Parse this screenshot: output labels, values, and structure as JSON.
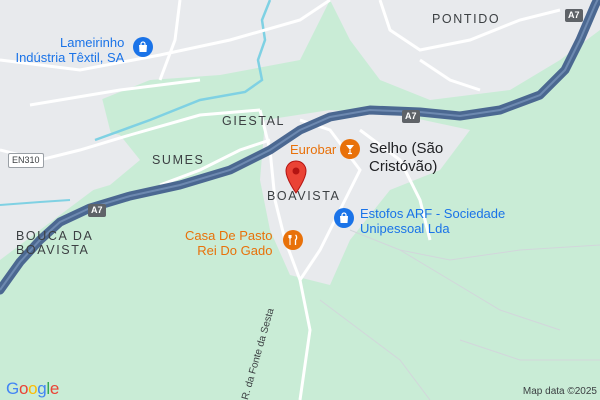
{
  "map": {
    "colors": {
      "land": "#e8eaed",
      "park": "#c9ecd6",
      "motorway": "#4b6891",
      "road": "#ffffff",
      "water": "#7fd1e3",
      "poi_blue": "#1a73e8",
      "poi_orange": "#e8710a",
      "marker": "#ea4335"
    },
    "places": {
      "pontido": "PONTIDO",
      "giestal": "GIESTAL",
      "sumes": "SUMES",
      "boavista": "BOAVISTA",
      "bouca_line1": "BOUCA DA",
      "bouca_line2": "BOAVISTA"
    },
    "town": {
      "line1": "Selho (São",
      "line2": "Cristóvão)"
    },
    "pois": {
      "lameirinho": {
        "line1": "Lameirinho",
        "line2": "Indústria Têxtil, SA",
        "icon": "shopping-bag-icon"
      },
      "eurobar": {
        "label": "Eurobar",
        "icon": "cocktail-glass-icon"
      },
      "estofos": {
        "line1": "Estofos ARF - Sociedade",
        "line2": "Unipessoal Lda",
        "icon": "shopping-bag-icon"
      },
      "casa": {
        "line1": "Casa De Pasto",
        "line2": "Rei Do Gado",
        "icon": "fork-knife-icon"
      }
    },
    "shields": {
      "a7_top": "A7",
      "a7_mid": "A7",
      "a7_left": "A7",
      "en310": "EN310"
    },
    "road_label": "R. da Fonte da Sesta",
    "marker": {
      "icon": "location-pin-icon"
    },
    "branding": {
      "logo": "Google",
      "attribution": "Map data ©2025"
    }
  }
}
